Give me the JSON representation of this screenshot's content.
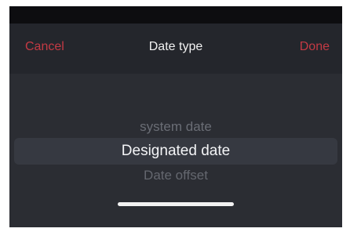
{
  "nav": {
    "cancel_label": "Cancel",
    "title": "Date type",
    "done_label": "Done"
  },
  "picker": {
    "options": [
      "system date",
      "Designated date",
      "Date offset"
    ],
    "selected_index": 1
  },
  "colors": {
    "accent": "#c43a44",
    "background": "#2b2d33",
    "status_bar": "#0d0d10"
  },
  "icons": {
    "home_indicator": "home-indicator-bar"
  }
}
